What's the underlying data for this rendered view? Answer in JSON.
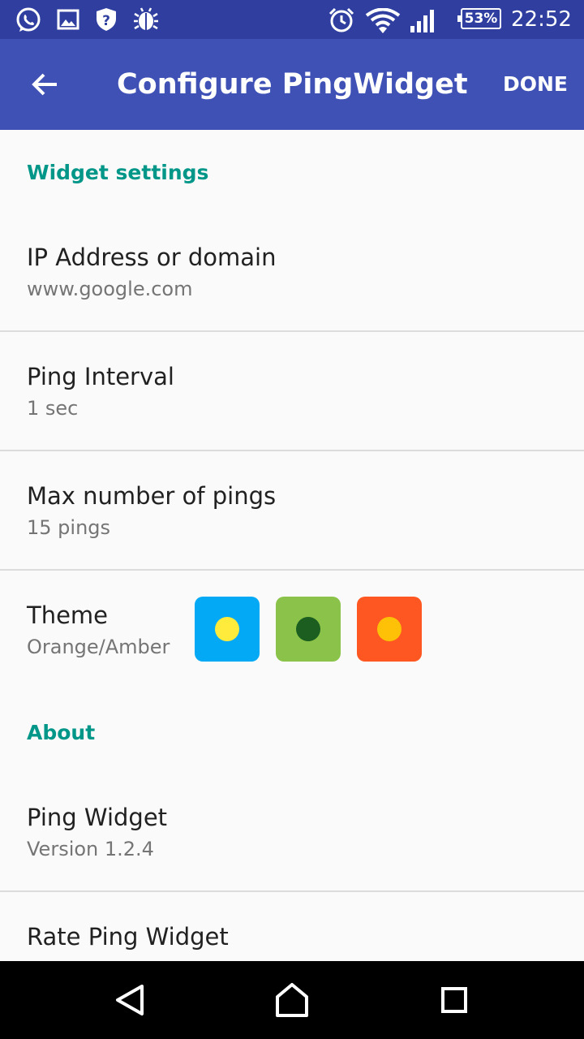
{
  "status_bar": {
    "icons": [
      "whatsapp-icon",
      "gallery-icon",
      "shield-question-icon",
      "bug-icon",
      "alarm-icon",
      "wifi-icon",
      "signal-icon",
      "battery-icon"
    ],
    "battery": "53%",
    "time": "22:52"
  },
  "app_bar": {
    "title": "Configure PingWidget",
    "done_label": "DONE",
    "back_icon": "arrow-back-icon"
  },
  "widget_settings": {
    "header": "Widget settings",
    "items": [
      {
        "title": "IP Address or domain",
        "summary": "www.google.com"
      },
      {
        "title": "Ping Interval",
        "summary": "1 sec"
      },
      {
        "title": "Max number of pings",
        "summary": "15 pings"
      },
      {
        "title": "Theme",
        "summary": "Orange/Amber"
      }
    ],
    "theme_swatches": [
      {
        "background": "#03a9f4",
        "dot": "#ffeb3b"
      },
      {
        "background": "#8bc34a",
        "dot": "#1b5e20"
      },
      {
        "background": "#ff5722",
        "dot": "#ffc107"
      }
    ]
  },
  "about": {
    "header": "About",
    "items": [
      {
        "title": "Ping Widget",
        "summary": "Version 1.2.4"
      },
      {
        "title": "Rate Ping Widget"
      }
    ]
  },
  "colors": {
    "status_bar": "#303f9f",
    "app_bar": "#3f51b5",
    "accent": "#009688"
  },
  "nav_bar": {
    "icons": [
      "back-triangle-icon",
      "home-icon",
      "recents-square-icon"
    ]
  }
}
